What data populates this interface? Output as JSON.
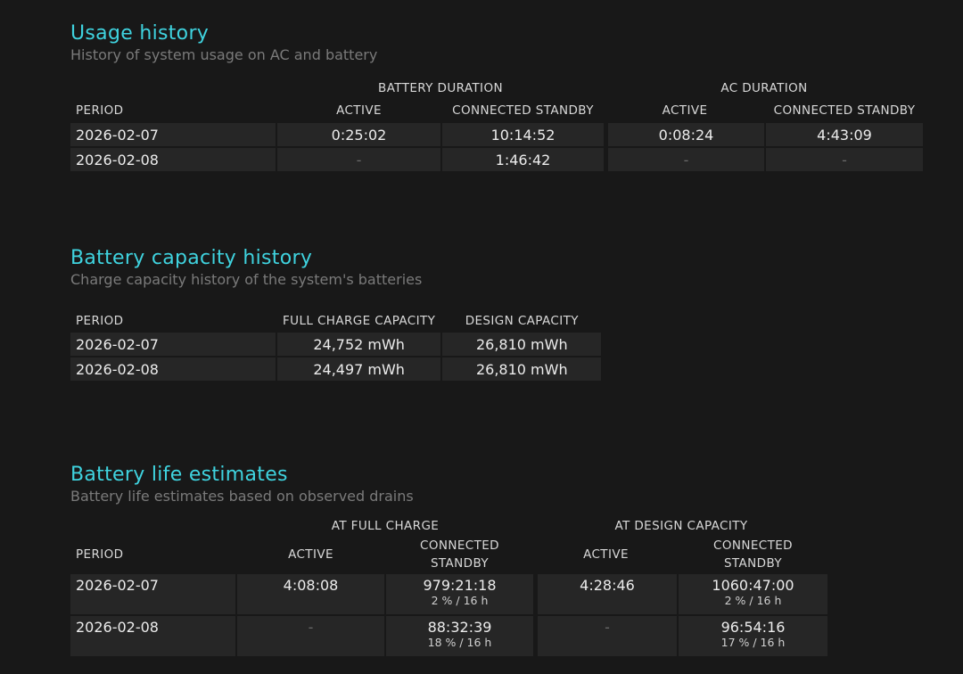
{
  "usage": {
    "title": "Usage history",
    "subtitle": "History of system usage on AC and battery",
    "group_battery": "BATTERY DURATION",
    "group_ac": "AC DURATION",
    "headers": {
      "period": "PERIOD",
      "bat_active": "ACTIVE",
      "bat_standby": "CONNECTED STANDBY",
      "ac_active": "ACTIVE",
      "ac_standby": "CONNECTED STANDBY"
    },
    "rows": [
      {
        "period": "2026-02-07",
        "bat_active": "0:25:02",
        "bat_standby": "10:14:52",
        "ac_active": "0:08:24",
        "ac_standby": "4:43:09"
      },
      {
        "period": "2026-02-08",
        "bat_active": "-",
        "bat_standby": "1:46:42",
        "ac_active": "-",
        "ac_standby": "-"
      }
    ]
  },
  "capacity": {
    "title": "Battery capacity history",
    "subtitle": "Charge capacity history of the system's batteries",
    "headers": {
      "period": "PERIOD",
      "full": "FULL CHARGE CAPACITY",
      "design": "DESIGN CAPACITY"
    },
    "rows": [
      {
        "period": "2026-02-07",
        "full": "24,752 mWh",
        "design": "26,810 mWh"
      },
      {
        "period": "2026-02-08",
        "full": "24,497 mWh",
        "design": "26,810 mWh"
      }
    ]
  },
  "estimates": {
    "title": "Battery life estimates",
    "subtitle": "Battery life estimates based on observed drains",
    "group_full": "AT FULL CHARGE",
    "group_design": "AT DESIGN CAPACITY",
    "headers": {
      "period": "PERIOD",
      "full_active": "ACTIVE",
      "full_standby_1": "CONNECTED",
      "full_standby_2": "STANDBY",
      "design_active": "ACTIVE",
      "design_standby_1": "CONNECTED",
      "design_standby_2": "STANDBY"
    },
    "rows": [
      {
        "period": "2026-02-07",
        "full_active": "4:08:08",
        "full_standby": "979:21:18",
        "full_standby_sub": "2 % / 16 h",
        "design_active": "4:28:46",
        "design_standby": "1060:47:00",
        "design_standby_sub": "2 % / 16 h"
      },
      {
        "period": "2026-02-08",
        "full_active": "-",
        "full_standby": "88:32:39",
        "full_standby_sub": "18 % / 16 h",
        "design_active": "-",
        "design_standby": "96:54:16",
        "design_standby_sub": "17 % / 16 h"
      }
    ]
  },
  "colors": {
    "background": "#181818",
    "title": "#3fd3df",
    "cell": "#262626"
  }
}
